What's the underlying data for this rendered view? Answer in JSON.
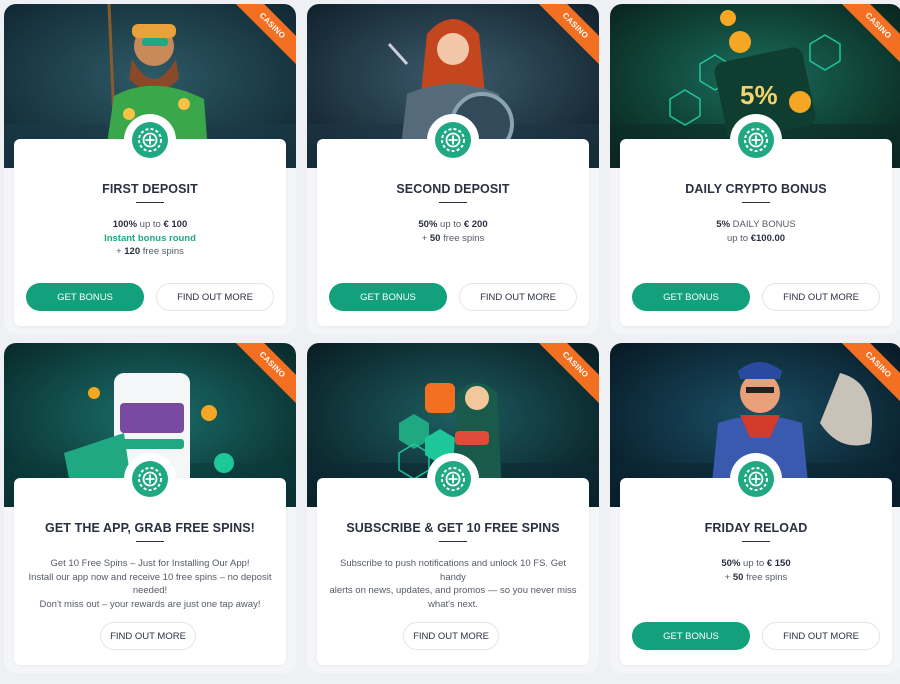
{
  "colors": {
    "accent": "#13a07d",
    "ribbon": "#f36f21",
    "title": "#2a3040"
  },
  "ribbon_label": "CASINO",
  "cards": [
    {
      "title": "FIRST DEPOSIT",
      "lines": [
        {
          "strong": "100%",
          "text": " up to ",
          "strong2": "€ 100"
        },
        {
          "green": "Instant bonus round"
        },
        {
          "text": "+ ",
          "strong": "120",
          "text2": " free spins"
        }
      ],
      "primary": "GET BONUS",
      "secondary": "FIND OUT MORE",
      "icon": "fisherman-character-image"
    },
    {
      "title": "SECOND DEPOSIT",
      "lines": [
        {
          "strong": "50%",
          "text": " up to ",
          "strong2": "€ 200"
        },
        {
          "text": "+ ",
          "strong": "50",
          "text2": " free spins"
        }
      ],
      "primary": "GET BONUS",
      "secondary": "FIND OUT MORE",
      "icon": "warrior-woman-image"
    },
    {
      "title": "DAILY CRYPTO BONUS",
      "lines": [
        {
          "strong": "5%",
          "text": " DAILY BONUS"
        },
        {
          "text": "up to ",
          "strong": "€100.00"
        }
      ],
      "primary": "GET BONUS",
      "secondary": "FIND OUT MORE",
      "icon": "crypto-wallet-image"
    },
    {
      "title": "GET THE APP, GRAB FREE SPINS!",
      "lines": [
        {
          "text": "Get 10 Free Spins – Just for Installing Our App!"
        },
        {
          "text": "Install our app now and receive 10 free spins – no deposit"
        },
        {
          "text": "needed!"
        },
        {
          "text": "Don't miss out – your rewards are just one tap away!"
        }
      ],
      "single": "FIND OUT MORE",
      "icon": "mobile-app-image"
    },
    {
      "title": "SUBSCRIBE & GET 10 FREE SPINS",
      "lines": [
        {
          "text": "Subscribe to push notifications and unlock 10 FS. Get handy"
        },
        {
          "text": "alerts on news, updates, and promos — so you never miss"
        },
        {
          "text": "what's next."
        }
      ],
      "single": "FIND OUT MORE",
      "icon": "notification-phone-image"
    },
    {
      "title": "FRIDAY RELOAD",
      "lines": [
        {
          "strong": "50%",
          "text": " up to ",
          "strong2": "€ 150"
        },
        {
          "text": "+ ",
          "strong": "50",
          "text2": " free spins"
        }
      ],
      "primary": "GET BONUS",
      "secondary": "FIND OUT MORE",
      "icon": "pirate-character-image"
    }
  ]
}
